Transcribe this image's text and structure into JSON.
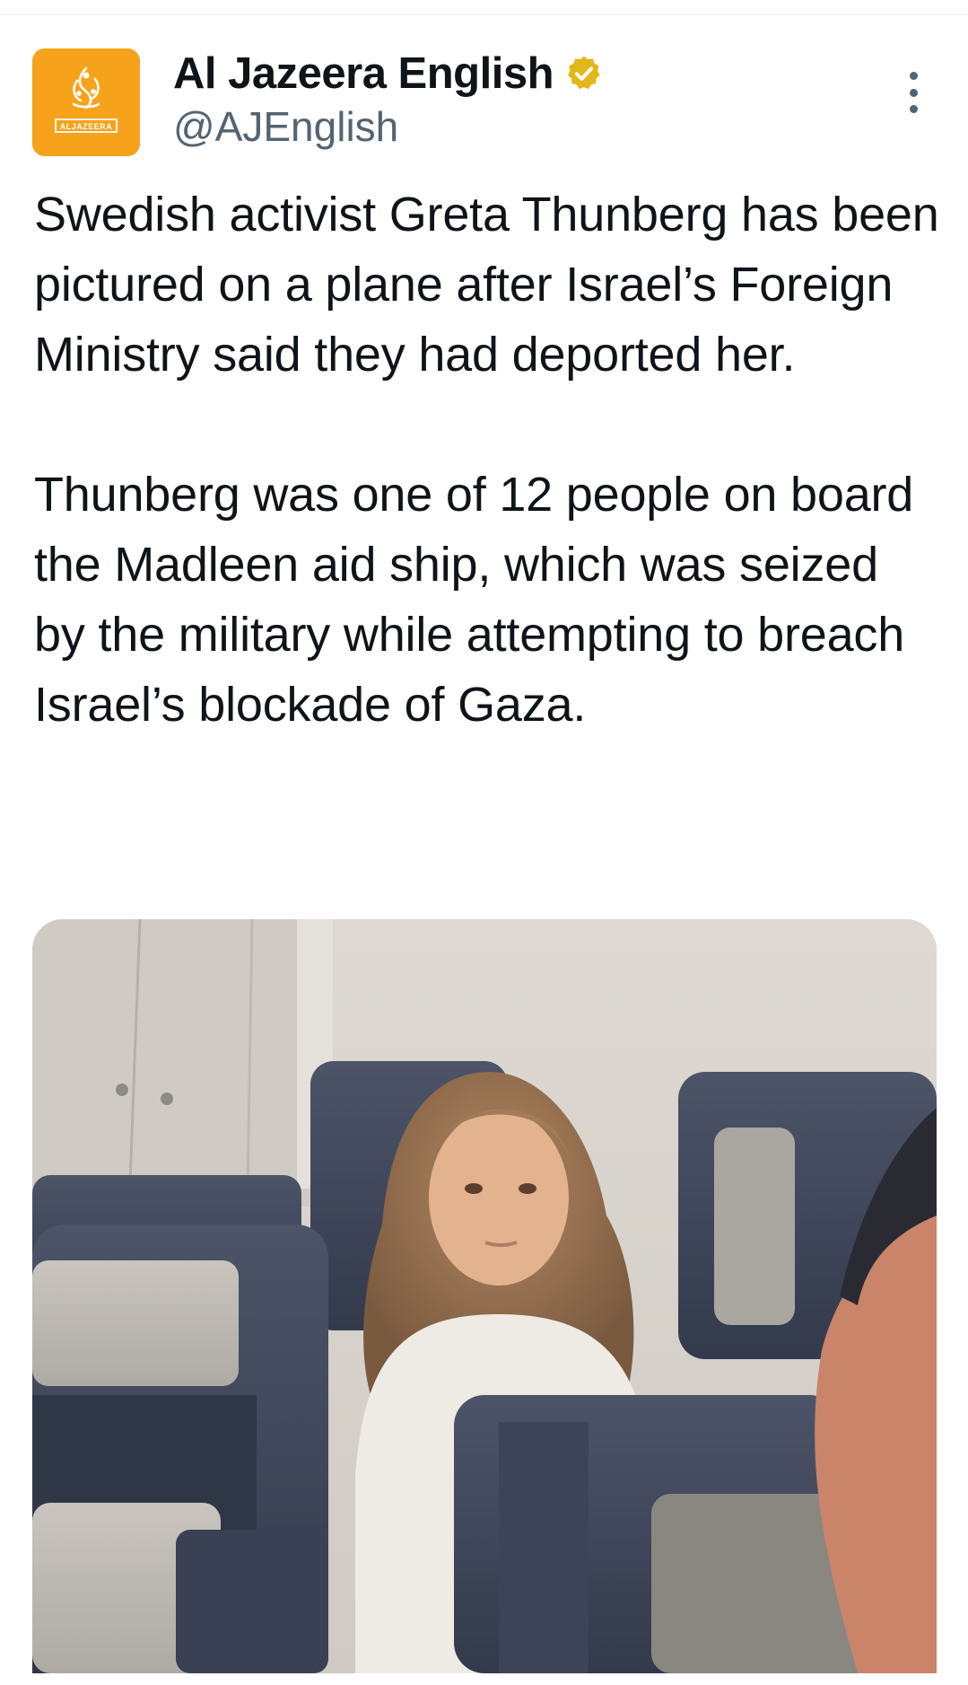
{
  "author": {
    "display_name": "Al Jazeera English",
    "handle": "@AJEnglish",
    "avatar_text": "ALJAZEERA",
    "verified_badge": "gold-verified-icon",
    "brand_color": "#f7a21b"
  },
  "tweet": {
    "paragraphs": [
      "Swedish activist Greta Thunberg has been pictured on a plane after Israel’s Foreign Ministry said they had deported her.",
      "Thunberg was one of 12 people on board the Madleen aid ship, which was seized by the military while attempting to breach Israel’s blockade of Gaza."
    ]
  },
  "icons": {
    "more": "more-options-icon",
    "verified": "verified-badge-icon"
  }
}
